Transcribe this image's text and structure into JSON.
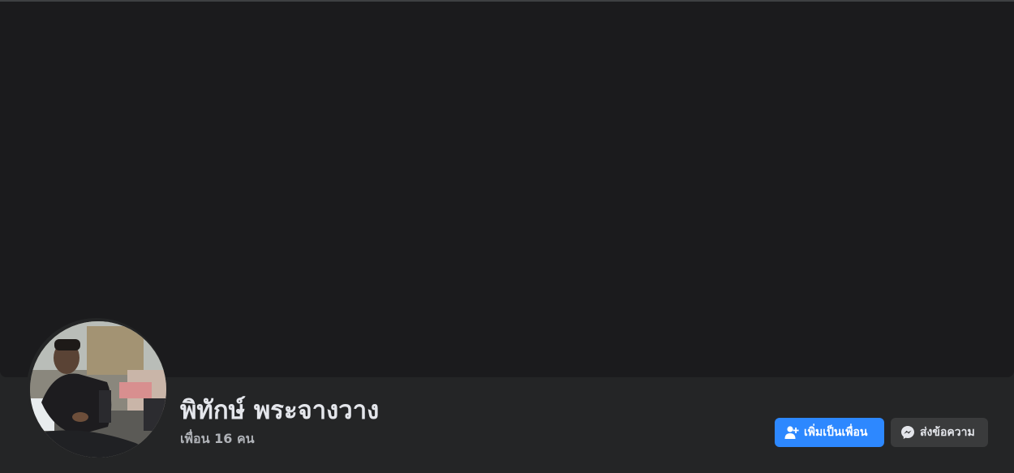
{
  "profile": {
    "name": "พิทักษ์ พระจางวาง",
    "friends_count": "เพื่อน 16 คน"
  },
  "actions": {
    "add_friend_label": "เพิ่มเป็นเพื่อน",
    "add_friend_icon": "person-add-icon",
    "message_label": "ส่งข้อความ",
    "message_icon": "messenger-icon"
  },
  "colors": {
    "page_background": "#242526",
    "cover_background": "#1b1b1d",
    "primary_button": "#2d88ff",
    "secondary_button": "#3a3b3c",
    "name_text": "#e4e6eb",
    "secondary_text": "#b0b3b8"
  }
}
